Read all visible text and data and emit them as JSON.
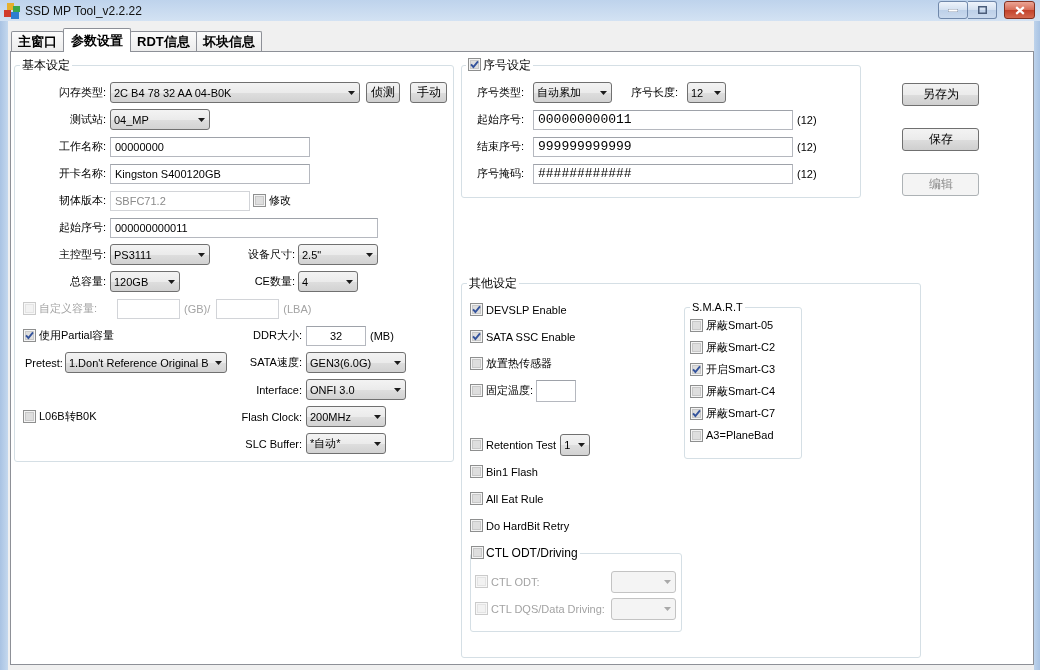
{
  "window": {
    "title": "SSD MP Tool_v2.2.22"
  },
  "tabs": [
    {
      "label": "主窗口",
      "selected": false
    },
    {
      "label": "参数设置",
      "selected": true
    },
    {
      "label": "RDT信息",
      "selected": false
    },
    {
      "label": "坏块信息",
      "selected": false
    }
  ],
  "basic_settings": {
    "title": "基本设定",
    "flash_type": {
      "label": "闪存类型:",
      "value": "2C B4 78 32 AA 04-B0K"
    },
    "detect_button": "侦测",
    "manual_button": "手动",
    "test_station": {
      "label": "测试站:",
      "value": "04_MP"
    },
    "work_name": {
      "label": "工作名称:",
      "value": "00000000"
    },
    "card_name": {
      "label": "开卡名称:",
      "value": "Kingston S400120GB"
    },
    "firmware_version": {
      "label": "韧体版本:",
      "value": "SBFC71.2",
      "disabled": true
    },
    "modify": {
      "label": "修改",
      "checked": false
    },
    "start_serial": {
      "label": "起始序号:",
      "value": "000000000011"
    },
    "controller": {
      "label": "主控型号:",
      "value": "PS3111"
    },
    "device_size": {
      "label": "设备尺寸:",
      "value": "2.5\""
    },
    "capacity": {
      "label": "总容量:",
      "value": "120GB"
    },
    "ce_count": {
      "label": "CE数量:",
      "value": "4"
    },
    "custom_capacity": {
      "label": "自定义容量:",
      "checked": false,
      "disabled": true,
      "gb_unit": "(GB)/",
      "lba_unit": "(LBA)"
    },
    "partial_capacity": {
      "label": "使用Partial容量",
      "checked": true
    },
    "ddr_size": {
      "label": "DDR大小:",
      "value": "32",
      "unit": "(MB)"
    },
    "pretest": {
      "label": "Pretest:",
      "value": "1.Don't Reference Original B"
    },
    "sata_speed": {
      "label": "SATA速度:",
      "value": "GEN3(6.0G)"
    },
    "interface": {
      "label": "Interface:",
      "value": "ONFI 3.0"
    },
    "l06b": {
      "label": "L06B转B0K",
      "checked": false
    },
    "flash_clock": {
      "label": "Flash Clock:",
      "value": "200MHz"
    },
    "slc_buffer": {
      "label": "SLC Buffer:",
      "value": "*自动*"
    }
  },
  "serial_settings": {
    "title": "序号设定",
    "checked": true,
    "serial_type": {
      "label": "序号类型:",
      "value": "自动累加"
    },
    "serial_length": {
      "label": "序号长度:",
      "value": "12"
    },
    "fields": [
      {
        "label": "起始序号:",
        "value": "000000000011",
        "suffix": "(12)"
      },
      {
        "label": "结束序号:",
        "value": "999999999999",
        "suffix": "(12)"
      },
      {
        "label": "序号掩码:",
        "value": "############",
        "suffix": "(12)"
      }
    ]
  },
  "buttons": [
    {
      "label": "另存为",
      "disabled": false
    },
    {
      "label": "保存",
      "disabled": false
    },
    {
      "label": "编辑",
      "disabled": true
    }
  ],
  "other_settings": {
    "title": "其他设定",
    "options": [
      {
        "kind": "plain",
        "label": "DEVSLP Enable",
        "checked": true
      },
      {
        "kind": "plain",
        "label": "SATA SSC Enable",
        "checked": true
      },
      {
        "kind": "plain",
        "label": "放置热传感器",
        "checked": false
      },
      {
        "kind": "field",
        "label": "固定温度:",
        "checked": false
      },
      {
        "kind": "select",
        "label": "Retention Test",
        "checked": false,
        "value": "1"
      },
      {
        "kind": "plain",
        "label": "Bin1 Flash",
        "checked": false
      },
      {
        "kind": "plain",
        "label": "All Eat Rule",
        "checked": false
      },
      {
        "kind": "plain",
        "label": "Do HardBit Retry",
        "checked": false
      }
    ],
    "ctl_group": {
      "label": "CTL ODT/Driving",
      "checked": false,
      "items": [
        {
          "label": "CTL ODT:",
          "checked": false,
          "disabled": true
        },
        {
          "label": "CTL DQS/Data Driving:",
          "checked": false,
          "disabled": true
        }
      ]
    },
    "smart": {
      "title": "S.M.A.R.T",
      "items": [
        {
          "label": "屏蔽Smart-05",
          "checked": false
        },
        {
          "label": "屏蔽Smart-C2",
          "checked": false
        },
        {
          "label": "开启Smart-C3",
          "checked": true
        },
        {
          "label": "屏蔽Smart-C4",
          "checked": false
        },
        {
          "label": "屏蔽Smart-C7",
          "checked": true
        },
        {
          "label": "A3=PlaneBad",
          "checked": false
        }
      ]
    }
  }
}
